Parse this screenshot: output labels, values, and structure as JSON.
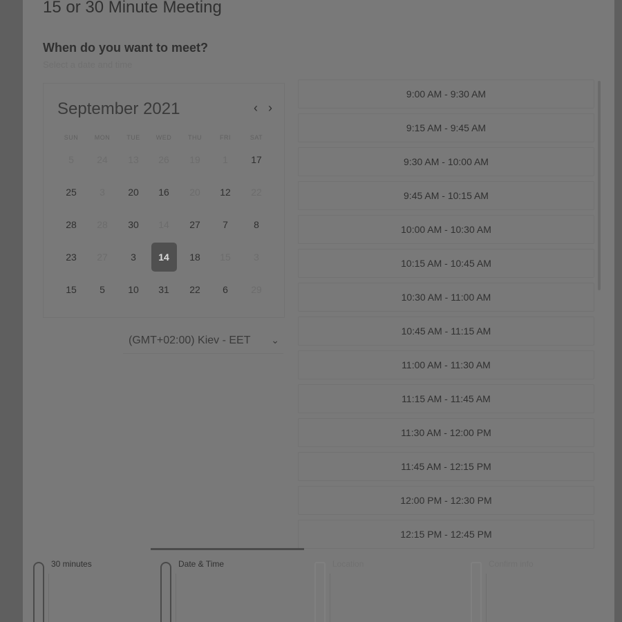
{
  "header": {
    "title": "15 or 30 Minute Meeting",
    "subtitle": "When do you want to meet?",
    "hint": "Select a date and time"
  },
  "calendar": {
    "month_label": "September 2021",
    "prev_label": "‹",
    "next_label": "›",
    "weekdays": [
      "SUN",
      "MON",
      "TUE",
      "WED",
      "THU",
      "FRI",
      "SAT"
    ],
    "weeks": [
      [
        "5",
        "24",
        "13",
        "26",
        "19",
        "1",
        "17"
      ],
      [
        "25",
        "3",
        "20",
        "16",
        "20",
        "12",
        "22"
      ],
      [
        "28",
        "28",
        "30",
        "14",
        "27",
        "7",
        "8"
      ],
      [
        "23",
        "27",
        "3",
        "14",
        "18",
        "15",
        "3"
      ],
      [
        "15",
        "5",
        "10",
        "31",
        "22",
        "6",
        "29"
      ]
    ],
    "selected_day": "14"
  },
  "timezone": {
    "value": "(GMT+02:00) Kiev - EET",
    "caret": "⌄"
  },
  "slots": [
    "9:00 AM - 9:30 AM",
    "9:15 AM - 9:45 AM",
    "9:30 AM - 10:00 AM",
    "9:45 AM - 10:15 AM",
    "10:00 AM - 10:30 AM",
    "10:15 AM - 10:45 AM",
    "10:30 AM - 11:00 AM",
    "10:45 AM - 11:15 AM",
    "11:00 AM - 11:30 AM",
    "11:15 AM - 11:45 AM",
    "11:30 AM - 12:00 PM",
    "11:45 AM - 12:15 PM",
    "12:00 PM - 12:30 PM",
    "12:15 PM - 12:45 PM"
  ],
  "steps": [
    {
      "label": "30 minutes",
      "icon": "clock-icon",
      "state": "done"
    },
    {
      "label": "Date & Time",
      "icon": "calendar-icon",
      "state": "active"
    },
    {
      "label": "Location",
      "icon": "location-pin-icon",
      "state": "pending"
    },
    {
      "label": "Confirm info",
      "icon": "person-icon",
      "state": "pending"
    }
  ],
  "colors": {
    "overlay_background": "#5f5f5f",
    "panel_background": "#797979",
    "selected_day_background": "#505050",
    "text_primary": "#303030",
    "text_muted": "#6c6c6c"
  }
}
